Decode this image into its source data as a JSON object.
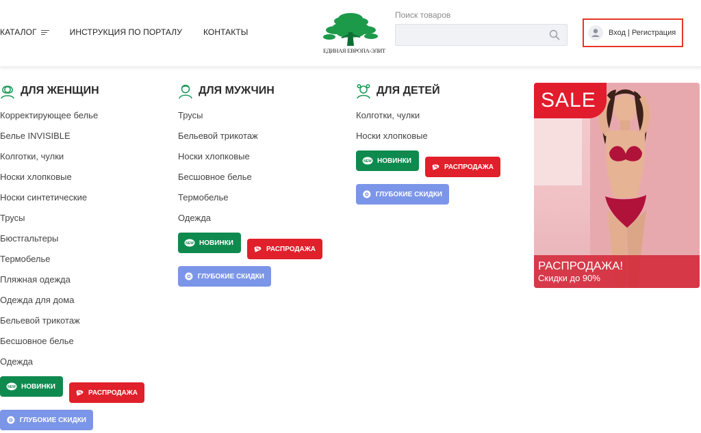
{
  "header": {
    "nav": {
      "catalog": "КАТАЛОГ",
      "instruction": "ИНСТРУКЦИЯ ПО ПОРТАЛУ",
      "contacts": "КОНТАКТЫ"
    },
    "logo_text": "ЕДИНАЯ ЕВРОПА-ЭЛИТ",
    "search": {
      "label": "Поиск товаров",
      "value": "",
      "placeholder": ""
    },
    "auth": {
      "login": "Вход",
      "separator": "|",
      "register": "Регистрация"
    }
  },
  "columns": {
    "women": {
      "title": "ДЛЯ ЖЕНЩИН",
      "links": [
        "Корректирующее белье",
        "Белье INVISIBLE",
        "Колготки, чулки",
        "Носки хлопковые",
        "Носки синтетические",
        "Трусы",
        "Бюстгальтеры",
        "Термобелье",
        "Пляжная одежда",
        "Одежда для дома",
        "Бельевой трикотаж",
        "Бесшовное белье",
        "Одежда"
      ]
    },
    "men": {
      "title": "ДЛЯ МУЖЧИН",
      "links": [
        "Трусы",
        "Бельевой трикотаж",
        "Носки хлопковые",
        "Бесшовное белье",
        "Термобелье",
        "Одежда"
      ]
    },
    "kids": {
      "title": "ДЛЯ ДЕТЕЙ",
      "links": [
        "Колготки, чулки",
        "Носки хлопковые"
      ]
    }
  },
  "badges": {
    "new": "НОВИНКИ",
    "sale": "РАСПРОДАЖА",
    "deep": "ГЛУБОКИЕ СКИДКИ",
    "new_icon_text": "NEW"
  },
  "banner": {
    "tag": "SALE",
    "title": "РАСПРОДАЖА!",
    "subtitle": "Скидки до 90%"
  },
  "colors": {
    "brand_green": "#0f8a4f",
    "sale_red": "#e0202a",
    "deep_blue": "#7b95e8",
    "auth_border": "#e53524"
  }
}
